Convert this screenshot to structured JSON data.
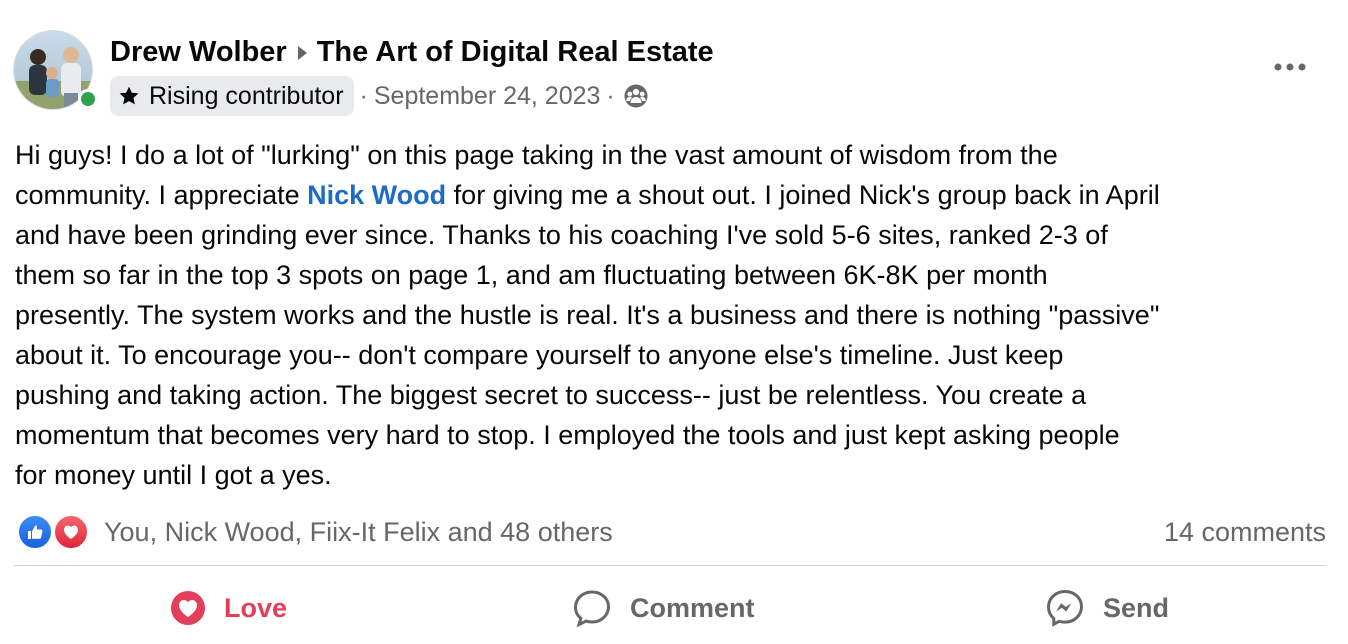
{
  "post": {
    "author": "Drew Wolber",
    "group": "The Art of Digital Real Estate",
    "badge": "Rising contributor",
    "date": "September 24, 2023",
    "separator_dot": "·",
    "more_label": "•••",
    "body_lines": [
      "Hi guys! I do a lot of \"lurking\" on this page taking in the vast amount of wisdom from the",
      "for giving me a shout out. I joined Nick's group back in April",
      "and have been grinding ever since. Thanks to his coaching I've sold 5-6 sites, ranked 2-3 of",
      "them so far in the top 3 spots on page 1, and am fluctuating between 6K-8K per month",
      "presently. The system works and the hustle is real. It's a business and there is nothing \"passive\"",
      "about it. To encourage you-- don't compare yourself to anyone else's timeline. Just keep",
      "pushing and taking action. The biggest secret to success-- just be relentless. You create a",
      "momentum that becomes very hard to stop. I employed the tools and just kept asking people",
      "for money until I got a yes."
    ],
    "line2_prefix": "community. I appreciate",
    "mention": "Nick Wood"
  },
  "reactions": {
    "summary": "You, Nick Wood, Fiix-It Felix and 48 others",
    "icons": [
      "like-icon",
      "love-icon"
    ]
  },
  "comments": {
    "count_label": "14 comments"
  },
  "actions": {
    "love_label": "Love",
    "comment_label": "Comment",
    "send_label": "Send"
  },
  "colors": {
    "text": "#080809",
    "secondary": "#65676b",
    "mention": "#1f6cc6",
    "love": "#e33f5a",
    "online": "#31a24c",
    "like_blue": "#1877f2"
  }
}
